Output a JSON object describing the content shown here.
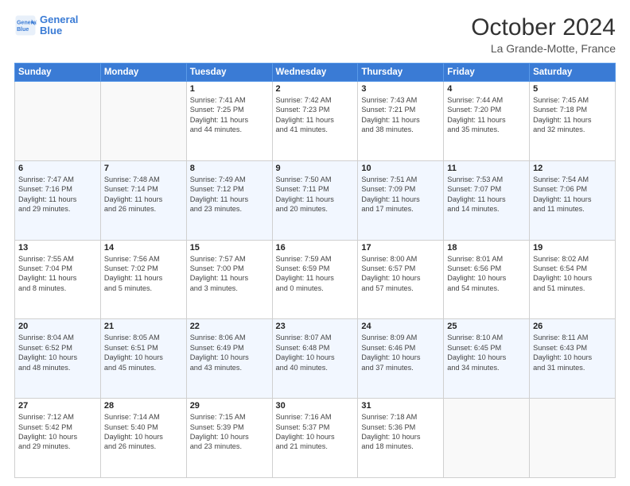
{
  "header": {
    "logo_line1": "General",
    "logo_line2": "Blue",
    "month": "October 2024",
    "location": "La Grande-Motte, France"
  },
  "weekdays": [
    "Sunday",
    "Monday",
    "Tuesday",
    "Wednesday",
    "Thursday",
    "Friday",
    "Saturday"
  ],
  "weeks": [
    [
      {
        "day": "",
        "empty": true
      },
      {
        "day": "",
        "empty": true
      },
      {
        "day": "1",
        "line1": "Sunrise: 7:41 AM",
        "line2": "Sunset: 7:25 PM",
        "line3": "Daylight: 11 hours",
        "line4": "and 44 minutes."
      },
      {
        "day": "2",
        "line1": "Sunrise: 7:42 AM",
        "line2": "Sunset: 7:23 PM",
        "line3": "Daylight: 11 hours",
        "line4": "and 41 minutes."
      },
      {
        "day": "3",
        "line1": "Sunrise: 7:43 AM",
        "line2": "Sunset: 7:21 PM",
        "line3": "Daylight: 11 hours",
        "line4": "and 38 minutes."
      },
      {
        "day": "4",
        "line1": "Sunrise: 7:44 AM",
        "line2": "Sunset: 7:20 PM",
        "line3": "Daylight: 11 hours",
        "line4": "and 35 minutes."
      },
      {
        "day": "5",
        "line1": "Sunrise: 7:45 AM",
        "line2": "Sunset: 7:18 PM",
        "line3": "Daylight: 11 hours",
        "line4": "and 32 minutes."
      }
    ],
    [
      {
        "day": "6",
        "line1": "Sunrise: 7:47 AM",
        "line2": "Sunset: 7:16 PM",
        "line3": "Daylight: 11 hours",
        "line4": "and 29 minutes."
      },
      {
        "day": "7",
        "line1": "Sunrise: 7:48 AM",
        "line2": "Sunset: 7:14 PM",
        "line3": "Daylight: 11 hours",
        "line4": "and 26 minutes."
      },
      {
        "day": "8",
        "line1": "Sunrise: 7:49 AM",
        "line2": "Sunset: 7:12 PM",
        "line3": "Daylight: 11 hours",
        "line4": "and 23 minutes."
      },
      {
        "day": "9",
        "line1": "Sunrise: 7:50 AM",
        "line2": "Sunset: 7:11 PM",
        "line3": "Daylight: 11 hours",
        "line4": "and 20 minutes."
      },
      {
        "day": "10",
        "line1": "Sunrise: 7:51 AM",
        "line2": "Sunset: 7:09 PM",
        "line3": "Daylight: 11 hours",
        "line4": "and 17 minutes."
      },
      {
        "day": "11",
        "line1": "Sunrise: 7:53 AM",
        "line2": "Sunset: 7:07 PM",
        "line3": "Daylight: 11 hours",
        "line4": "and 14 minutes."
      },
      {
        "day": "12",
        "line1": "Sunrise: 7:54 AM",
        "line2": "Sunset: 7:06 PM",
        "line3": "Daylight: 11 hours",
        "line4": "and 11 minutes."
      }
    ],
    [
      {
        "day": "13",
        "line1": "Sunrise: 7:55 AM",
        "line2": "Sunset: 7:04 PM",
        "line3": "Daylight: 11 hours",
        "line4": "and 8 minutes."
      },
      {
        "day": "14",
        "line1": "Sunrise: 7:56 AM",
        "line2": "Sunset: 7:02 PM",
        "line3": "Daylight: 11 hours",
        "line4": "and 5 minutes."
      },
      {
        "day": "15",
        "line1": "Sunrise: 7:57 AM",
        "line2": "Sunset: 7:00 PM",
        "line3": "Daylight: 11 hours",
        "line4": "and 3 minutes."
      },
      {
        "day": "16",
        "line1": "Sunrise: 7:59 AM",
        "line2": "Sunset: 6:59 PM",
        "line3": "Daylight: 11 hours",
        "line4": "and 0 minutes."
      },
      {
        "day": "17",
        "line1": "Sunrise: 8:00 AM",
        "line2": "Sunset: 6:57 PM",
        "line3": "Daylight: 10 hours",
        "line4": "and 57 minutes."
      },
      {
        "day": "18",
        "line1": "Sunrise: 8:01 AM",
        "line2": "Sunset: 6:56 PM",
        "line3": "Daylight: 10 hours",
        "line4": "and 54 minutes."
      },
      {
        "day": "19",
        "line1": "Sunrise: 8:02 AM",
        "line2": "Sunset: 6:54 PM",
        "line3": "Daylight: 10 hours",
        "line4": "and 51 minutes."
      }
    ],
    [
      {
        "day": "20",
        "line1": "Sunrise: 8:04 AM",
        "line2": "Sunset: 6:52 PM",
        "line3": "Daylight: 10 hours",
        "line4": "and 48 minutes."
      },
      {
        "day": "21",
        "line1": "Sunrise: 8:05 AM",
        "line2": "Sunset: 6:51 PM",
        "line3": "Daylight: 10 hours",
        "line4": "and 45 minutes."
      },
      {
        "day": "22",
        "line1": "Sunrise: 8:06 AM",
        "line2": "Sunset: 6:49 PM",
        "line3": "Daylight: 10 hours",
        "line4": "and 43 minutes."
      },
      {
        "day": "23",
        "line1": "Sunrise: 8:07 AM",
        "line2": "Sunset: 6:48 PM",
        "line3": "Daylight: 10 hours",
        "line4": "and 40 minutes."
      },
      {
        "day": "24",
        "line1": "Sunrise: 8:09 AM",
        "line2": "Sunset: 6:46 PM",
        "line3": "Daylight: 10 hours",
        "line4": "and 37 minutes."
      },
      {
        "day": "25",
        "line1": "Sunrise: 8:10 AM",
        "line2": "Sunset: 6:45 PM",
        "line3": "Daylight: 10 hours",
        "line4": "and 34 minutes."
      },
      {
        "day": "26",
        "line1": "Sunrise: 8:11 AM",
        "line2": "Sunset: 6:43 PM",
        "line3": "Daylight: 10 hours",
        "line4": "and 31 minutes."
      }
    ],
    [
      {
        "day": "27",
        "line1": "Sunrise: 7:12 AM",
        "line2": "Sunset: 5:42 PM",
        "line3": "Daylight: 10 hours",
        "line4": "and 29 minutes."
      },
      {
        "day": "28",
        "line1": "Sunrise: 7:14 AM",
        "line2": "Sunset: 5:40 PM",
        "line3": "Daylight: 10 hours",
        "line4": "and 26 minutes."
      },
      {
        "day": "29",
        "line1": "Sunrise: 7:15 AM",
        "line2": "Sunset: 5:39 PM",
        "line3": "Daylight: 10 hours",
        "line4": "and 23 minutes."
      },
      {
        "day": "30",
        "line1": "Sunrise: 7:16 AM",
        "line2": "Sunset: 5:37 PM",
        "line3": "Daylight: 10 hours",
        "line4": "and 21 minutes."
      },
      {
        "day": "31",
        "line1": "Sunrise: 7:18 AM",
        "line2": "Sunset: 5:36 PM",
        "line3": "Daylight: 10 hours",
        "line4": "and 18 minutes."
      },
      {
        "day": "",
        "empty": true
      },
      {
        "day": "",
        "empty": true
      }
    ]
  ]
}
